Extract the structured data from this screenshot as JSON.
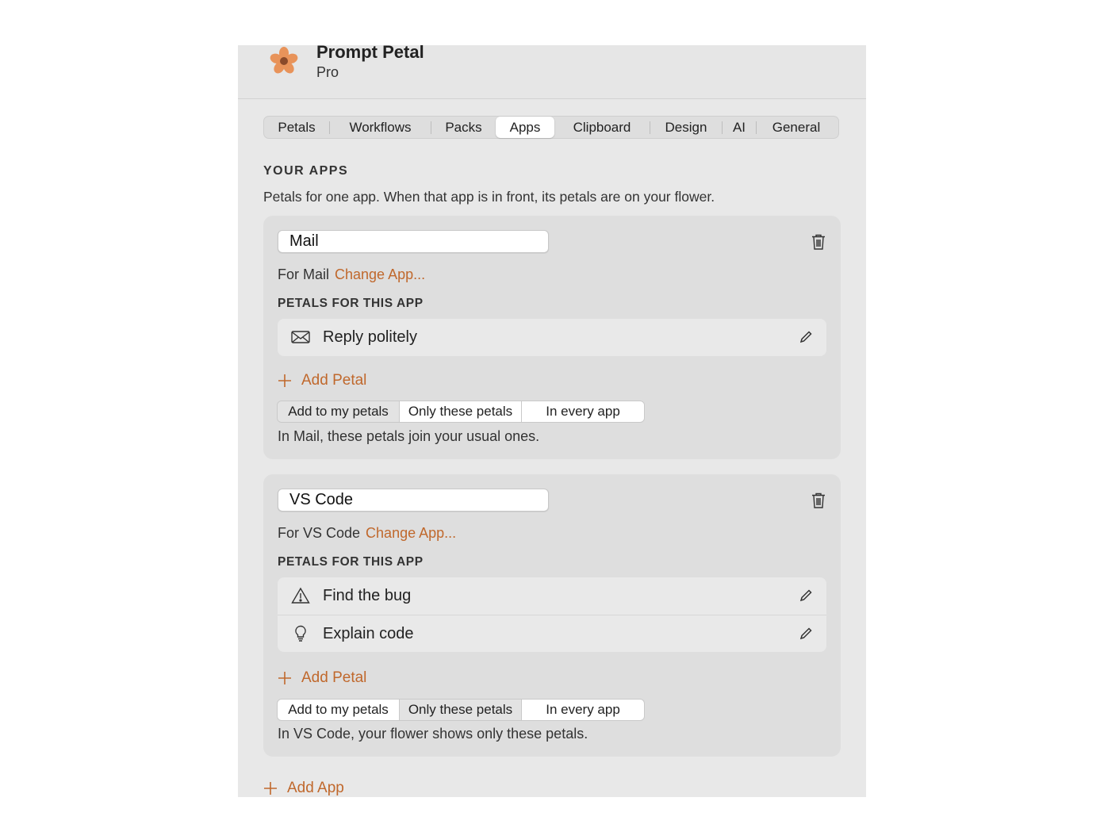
{
  "app": {
    "title": "Prompt Petal",
    "subtitle": "Pro"
  },
  "tabs": [
    {
      "label": "Petals"
    },
    {
      "label": "Workflows"
    },
    {
      "label": "Packs"
    },
    {
      "label": "Apps",
      "active": true
    },
    {
      "label": "Clipboard"
    },
    {
      "label": "Design"
    },
    {
      "label": "AI"
    },
    {
      "label": "General"
    }
  ],
  "section": {
    "title": "YOUR APPS",
    "description": "Petals for one app. When that app is in front, its petals are on your flower."
  },
  "apps": [
    {
      "name": "Mail",
      "for_text": "For Mail",
      "change_label": "Change App...",
      "petals_label": "PETALS FOR THIS APP",
      "petals": [
        {
          "icon": "envelope-icon",
          "label": "Reply politely"
        }
      ],
      "add_petal_label": "Add Petal",
      "modes": [
        "Add to my petals",
        "Only these petals",
        "In every app"
      ],
      "selected_mode": "Add to my petals",
      "mode_description": "In Mail, these petals join your usual ones."
    },
    {
      "name": "VS Code",
      "for_text": "For VS Code",
      "change_label": "Change App...",
      "petals_label": "PETALS FOR THIS APP",
      "petals": [
        {
          "icon": "warning-triangle-icon",
          "label": "Find the bug"
        },
        {
          "icon": "lightbulb-icon",
          "label": "Explain code"
        }
      ],
      "add_petal_label": "Add Petal",
      "modes": [
        "Add to my petals",
        "Only these petals",
        "In every app"
      ],
      "selected_mode": "Only these petals",
      "mode_description": "In VS Code, your flower shows only these petals."
    }
  ],
  "add_app_label": "Add App",
  "colors": {
    "accent": "#c0682c",
    "logo_petal": "#e8935a",
    "logo_center": "#8a4a2a"
  }
}
